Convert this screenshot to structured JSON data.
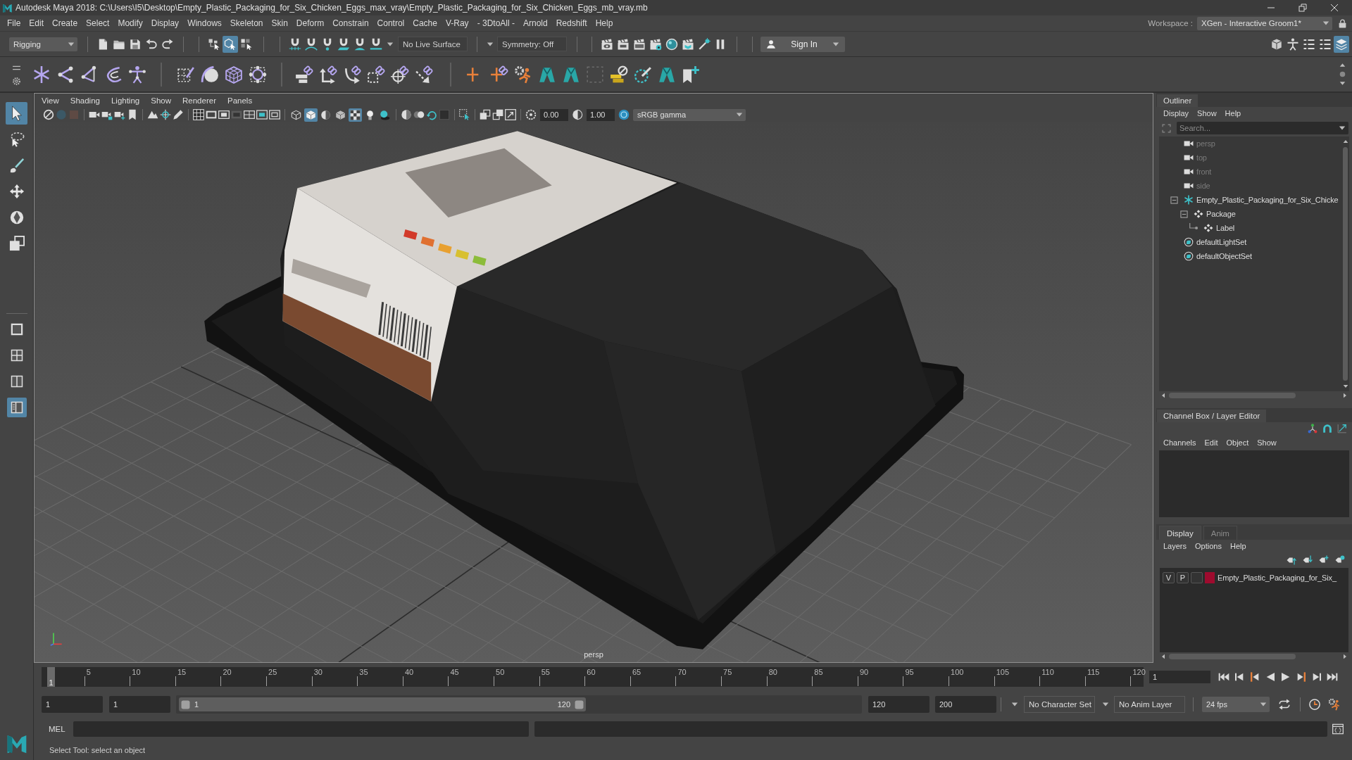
{
  "window": {
    "title": "Autodesk Maya 2018: C:\\Users\\I5\\Desktop\\Empty_Plastic_Packaging_for_Six_Chicken_Eggs_max_vray\\Empty_Plastic_Packaging_for_Six_Chicken_Eggs_mb_vray.mb"
  },
  "menu_bar": {
    "menus": [
      "File",
      "Edit",
      "Create",
      "Select",
      "Modify",
      "Display",
      "Windows",
      "Skeleton",
      "Skin",
      "Deform",
      "Constrain",
      "Control",
      "Cache",
      "V-Ray",
      "- 3DtoAll -",
      "Arnold",
      "Redshift",
      "Help"
    ],
    "workspace_label": "Workspace :",
    "workspace": "XGen - Interactive Groom1*"
  },
  "status_line": {
    "menu_set": "Rigging",
    "select_modes": [
      {
        "kind": "hierarchy",
        "selected": false
      },
      {
        "kind": "object",
        "selected": true
      },
      {
        "kind": "component",
        "selected": false
      }
    ],
    "live_surface": "No Live Surface",
    "symmetry": "Symmetry: Off",
    "sign_in": "Sign In",
    "panel_toggles": [
      {
        "kind": "modeling-toolkit",
        "selected": false
      },
      {
        "kind": "attribute-editor",
        "selected": false
      },
      {
        "kind": "tool-settings",
        "selected": false
      },
      {
        "kind": "channel-box",
        "selected": false
      },
      {
        "kind": "layer-editor",
        "selected": true
      }
    ]
  },
  "toolbox": {
    "tools": [
      {
        "kind": "select",
        "selected": true
      },
      {
        "kind": "lasso",
        "selected": false
      },
      {
        "kind": "paint",
        "selected": false
      },
      {
        "kind": "move",
        "selected": false
      },
      {
        "kind": "rotate",
        "selected": false
      },
      {
        "kind": "scale",
        "selected": false
      }
    ],
    "layouts": [
      {
        "kind": "single",
        "selected": false
      },
      {
        "kind": "four",
        "selected": false
      },
      {
        "kind": "side-by-side",
        "selected": false
      },
      {
        "kind": "outliner-persp",
        "selected": true
      }
    ]
  },
  "viewport": {
    "menus": [
      "View",
      "Shading",
      "Lighting",
      "Show",
      "Renderer",
      "Panels"
    ],
    "shading_modes": [
      {
        "kind": "wireframe",
        "selected": false
      },
      {
        "kind": "smooth-shade",
        "selected": true
      },
      {
        "kind": "default-material",
        "selected": false
      },
      {
        "kind": "wireframe-on-shaded",
        "selected": false
      },
      {
        "kind": "textured",
        "selected": true
      },
      {
        "kind": "all-lights",
        "selected": false
      },
      {
        "kind": "shadows",
        "selected": false
      }
    ],
    "exposure": "0.00",
    "gamma": "1.00",
    "color_space": "sRGB gamma",
    "camera": "persp"
  },
  "outliner": {
    "title": "Outliner",
    "menus": [
      "Display",
      "Show",
      "Help"
    ],
    "search": {
      "placeholder": "Search..."
    },
    "items": [
      {
        "label": "persp",
        "kind": "camera",
        "dimmed": true
      },
      {
        "label": "top",
        "kind": "camera",
        "dimmed": true
      },
      {
        "label": "front",
        "kind": "camera",
        "dimmed": true
      },
      {
        "label": "side",
        "kind": "camera",
        "dimmed": true
      },
      {
        "label": "Empty_Plastic_Packaging_for_Six_Chicke",
        "kind": "group",
        "dimmed": false,
        "expanded": true,
        "children": [
          {
            "label": "Package",
            "kind": "transform",
            "dimmed": false,
            "expanded": true,
            "children": [
              {
                "label": "Label",
                "kind": "transform",
                "dimmed": false
              }
            ]
          }
        ]
      },
      {
        "label": "defaultLightSet",
        "kind": "set",
        "dimmed": false
      },
      {
        "label": "defaultObjectSet",
        "kind": "set",
        "dimmed": false
      }
    ]
  },
  "channel_box": {
    "title": "Channel Box / Layer Editor",
    "menus": [
      "Channels",
      "Edit",
      "Object",
      "Show"
    ]
  },
  "layer_editor": {
    "tabs": [
      {
        "label": "Display",
        "selected": true
      },
      {
        "label": "Anim",
        "selected": false
      }
    ],
    "menus": [
      "Layers",
      "Options",
      "Help"
    ],
    "layers": [
      {
        "visibility": "V",
        "playback": "P",
        "name": "Empty_Plastic_Packaging_for_Six_",
        "color": "#9e0b2e"
      }
    ]
  },
  "time_slider": {
    "labels": [
      "5",
      "10",
      "15",
      "20",
      "25",
      "30",
      "35",
      "40",
      "45",
      "50",
      "55",
      "60",
      "65",
      "70",
      "75",
      "80",
      "85",
      "90",
      "95",
      "100",
      "105",
      "110",
      "115",
      "120"
    ],
    "current_frame": "1",
    "level": 0,
    "frame_field": "1"
  },
  "range_slider": {
    "animation_start": "1",
    "playback_start": "1",
    "range_start": "1",
    "range_end": "120",
    "level": 0.6,
    "playback_end": "120",
    "animation_end": "200",
    "character_set": "No Character Set",
    "anim_layer": "No Anim Layer",
    "fps": "24 fps"
  },
  "command_line": {
    "language": "MEL"
  },
  "help_line": "Select Tool: select an object"
}
